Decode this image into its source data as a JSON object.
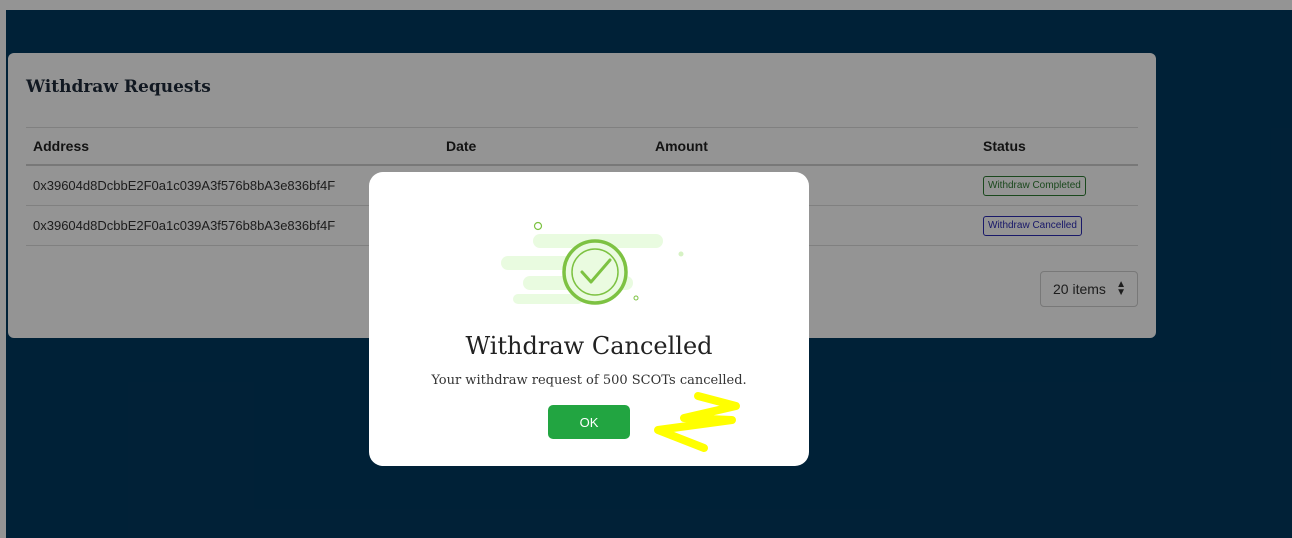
{
  "card": {
    "title": "Withdraw Requests",
    "columns": [
      "Address",
      "Date",
      "Amount",
      "Status"
    ],
    "rows": [
      {
        "address": "0x39604d8DcbbE2F0a1c039A3f576b8bA3e836bf4F",
        "date": "",
        "amount": "",
        "status": "Withdraw Completed"
      },
      {
        "address": "0x39604d8DcbbE2F0a1c039A3f576b8bA3e836bf4F",
        "date": "",
        "amount": "",
        "status": "Withdraw Cancelled"
      }
    ],
    "page_size": "20 items"
  },
  "modal": {
    "title": "Withdraw Cancelled",
    "message": "Your withdraw request of 500 SCOTs cancelled.",
    "ok_label": "OK"
  },
  "colors": {
    "background": "#01395f",
    "ok_button": "#22a541",
    "badge_completed": "#2e7d32",
    "badge_cancelled": "#2b2bb5",
    "check_icon": "#7dc242",
    "annotation": "#ffff00"
  }
}
